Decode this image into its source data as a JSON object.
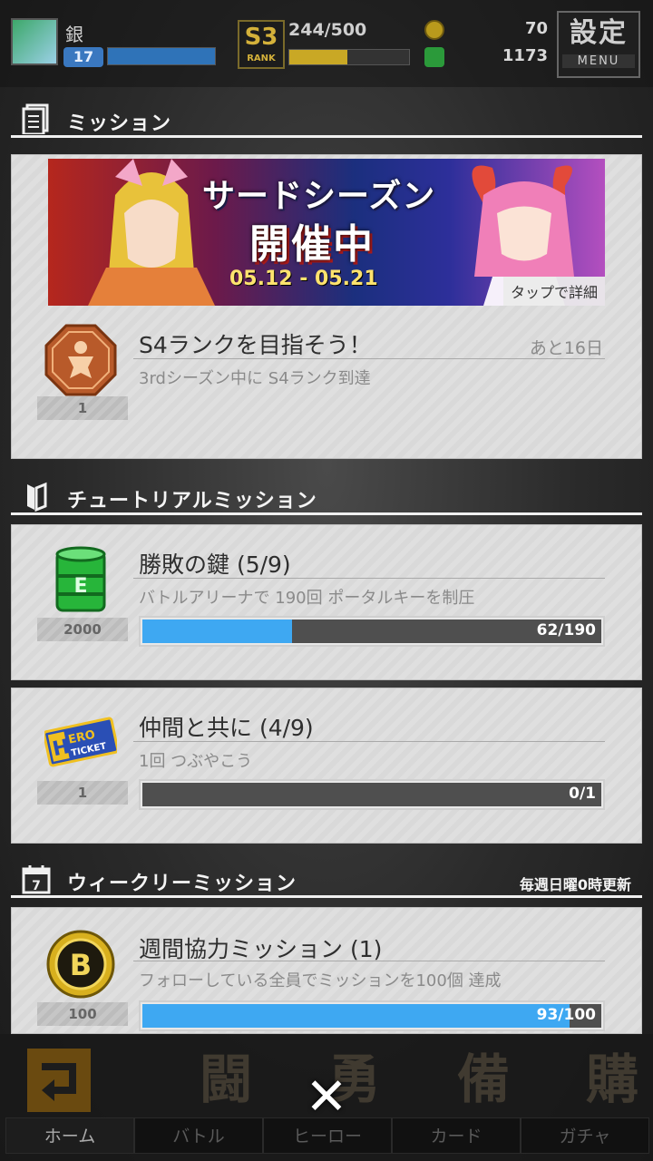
{
  "status": {
    "user_name": "銀",
    "level": "17",
    "rank": {
      "badge": "S3",
      "label": "RANK",
      "points": "244/500",
      "progress": 0.488
    },
    "currency_gold": "70",
    "currency_green": "1173",
    "menu": {
      "label": "設定",
      "sub": "MENU"
    }
  },
  "sections": {
    "missions": {
      "title": "ミッション"
    },
    "tutorial": {
      "title": "チュートリアルミッション"
    },
    "weekly": {
      "title": "ウィークリーミッション",
      "note": "毎週日曜0時更新"
    }
  },
  "banner": {
    "title_line1": "サードシーズン",
    "title_line2": "開催中",
    "dates": "05.12 - 05.21",
    "detail_label": "タップで詳細"
  },
  "missions": [
    {
      "title": "S4ランクを目指そう！",
      "description": "3rdシーズン中に S4ランク到達",
      "remaining": "あと16日",
      "reward_count": "1",
      "reward_icon": "rank-medal-icon"
    }
  ],
  "tutorial_missions": [
    {
      "title": "勝敗の鍵 (5/9)",
      "description": "バトルアリーナで 190回 ポータルキーを制圧",
      "reward_count": "2000",
      "reward_icon": "green-can-icon",
      "progress_text": "62/190",
      "progress": 0.326
    },
    {
      "title": "仲間と共に (4/9)",
      "description": "1回 つぶやこう",
      "reward_count": "1",
      "reward_icon": "hero-ticket-icon",
      "progress_text": "0/1",
      "progress": 0
    }
  ],
  "weekly_missions": [
    {
      "title": "週間協力ミッション (1)",
      "description": "フォローしている全員でミッションを100個 達成",
      "reward_count": "100",
      "reward_icon": "gold-coin-icon",
      "progress_text": "93/100",
      "progress": 0.93
    }
  ],
  "nav": [
    {
      "label": "ホーム",
      "icon_char": "",
      "active": true
    },
    {
      "label": "バトル",
      "icon_char": "闘"
    },
    {
      "label": "ヒーロー",
      "icon_char": "勇"
    },
    {
      "label": "カード",
      "icon_char": "備"
    },
    {
      "label": "ガチャ",
      "icon_char": "購"
    }
  ],
  "colors": {
    "progress_blue": "#3ea8f2",
    "rank_gold": "#c9a825"
  }
}
